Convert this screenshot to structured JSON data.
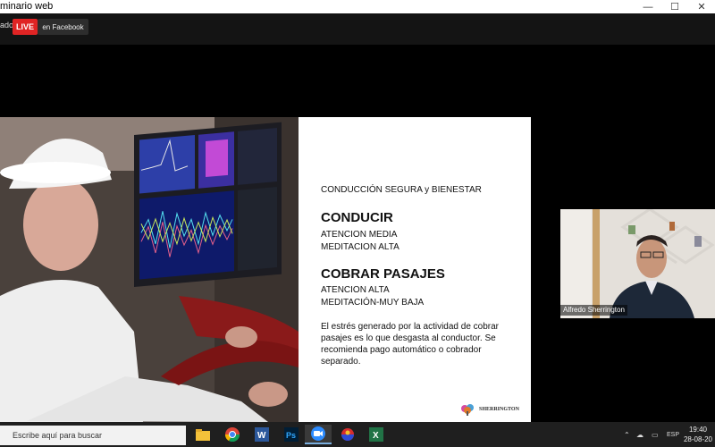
{
  "window": {
    "title": "minario web"
  },
  "topbar": {
    "recording_label": "ado",
    "live_label": "LIVE",
    "facebook_label": "en Facebook"
  },
  "slide": {
    "heading": "CONDUCCIÓN SEGURA  y BIENESTAR",
    "section1": {
      "title": "CONDUCIR",
      "line1": "ATENCION MEDIA",
      "line2": "MEDITACION ALTA"
    },
    "section2": {
      "title": "COBRAR PASAJES",
      "line1": "ATENCION ALTA",
      "line2": "MEDITACIÓN-MUY BAJA"
    },
    "paragraph": "El estrés generado por la actividad de cobrar pasajes es lo que desgasta al conductor. Se recomienda pago automático o cobrador separado.",
    "logo": "SHERRINGTON"
  },
  "participant": {
    "name": "Alfredo Sherrington"
  },
  "taskbar": {
    "search_placeholder": "Escribe aquí para buscar",
    "apps": [
      "file-explorer",
      "chrome",
      "word",
      "photoshop",
      "zoom",
      "app",
      "excel"
    ],
    "language": "ESP",
    "time": "19:40",
    "date": "28-08-20"
  }
}
